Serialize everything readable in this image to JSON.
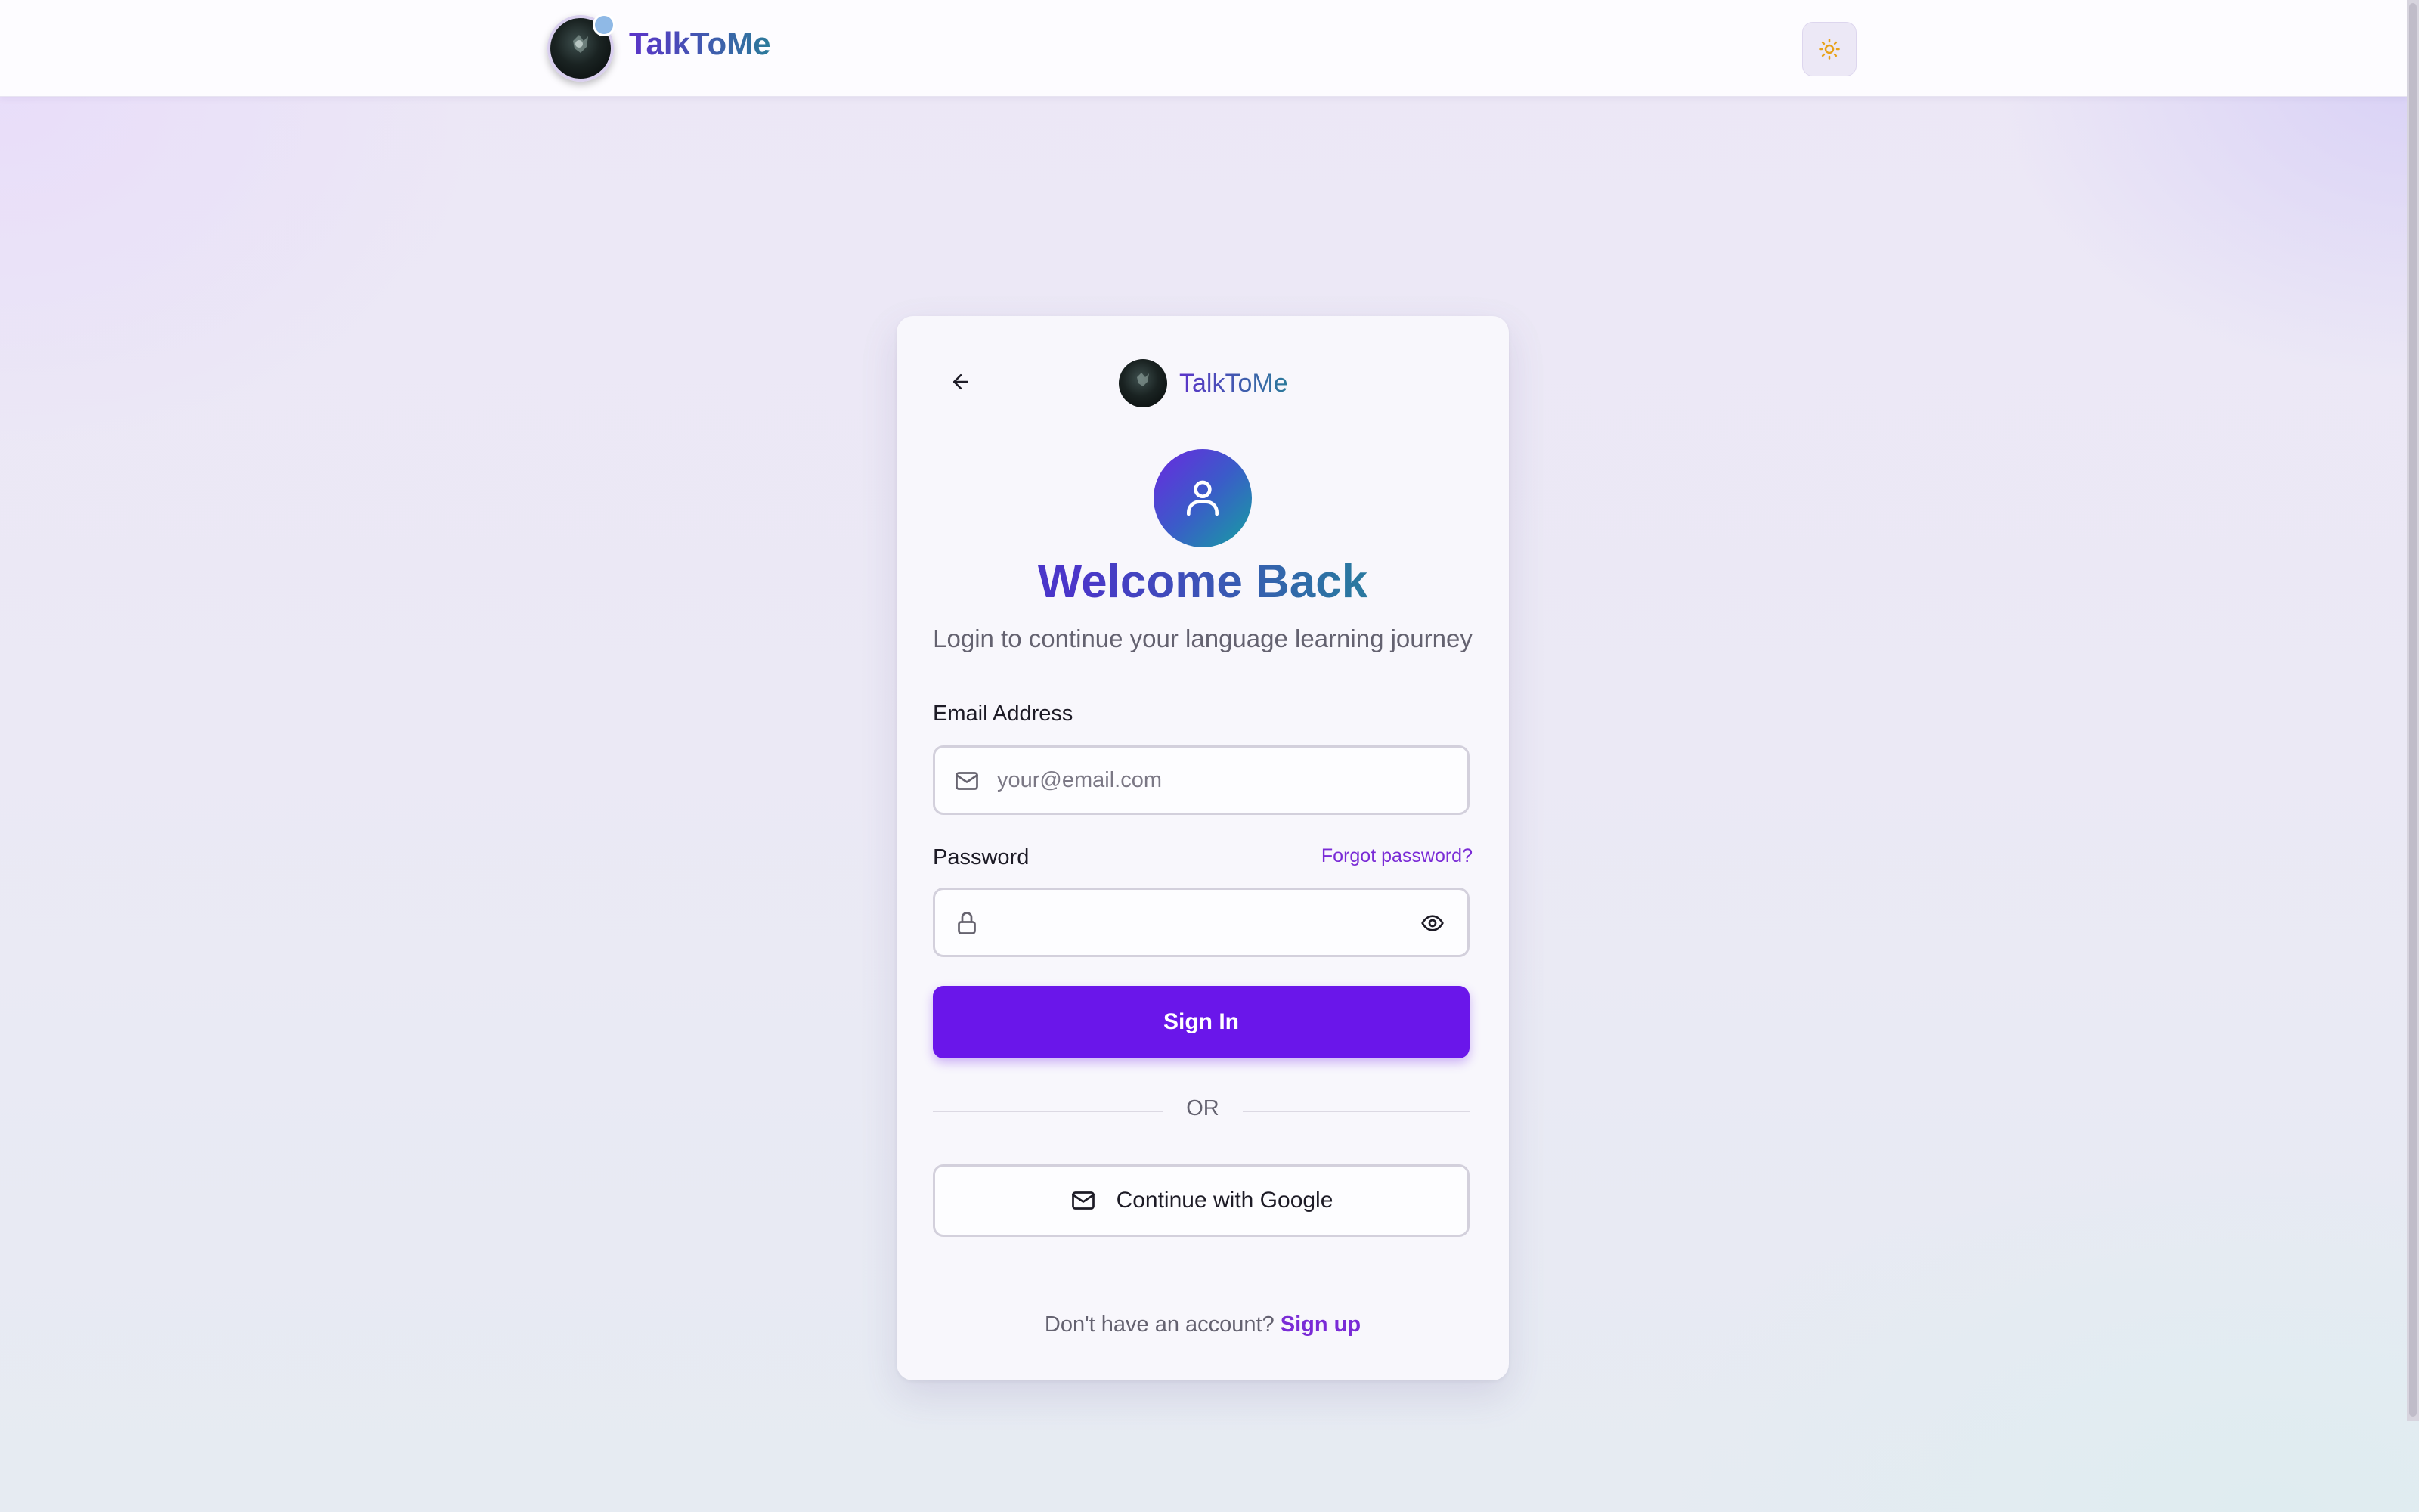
{
  "header": {
    "brand": "TalkToMe",
    "theme_toggle_icon": "sun-icon"
  },
  "card": {
    "brand": "TalkToMe",
    "back_icon": "arrow-left-icon",
    "avatar_icon": "user-icon",
    "title": "Welcome Back",
    "subtitle": "Login to continue your language learning journey",
    "email": {
      "label": "Email Address",
      "placeholder": "your@email.com",
      "value": "",
      "icon": "mail-icon"
    },
    "password": {
      "label": "Password",
      "forgot_label": "Forgot password?",
      "value": "",
      "icon": "lock-icon",
      "toggle_icon": "eye-icon"
    },
    "signin_label": "Sign In",
    "divider_label": "OR",
    "google_label": "Continue with Google",
    "google_icon": "mail-icon",
    "signup_prompt": "Don't have an account?",
    "signup_link": "Sign up"
  },
  "colors": {
    "accent": "#6a16ea",
    "link": "#7a2bd6",
    "brand_gradient_start": "#5b33c9",
    "brand_gradient_end": "#2b7a9a"
  }
}
